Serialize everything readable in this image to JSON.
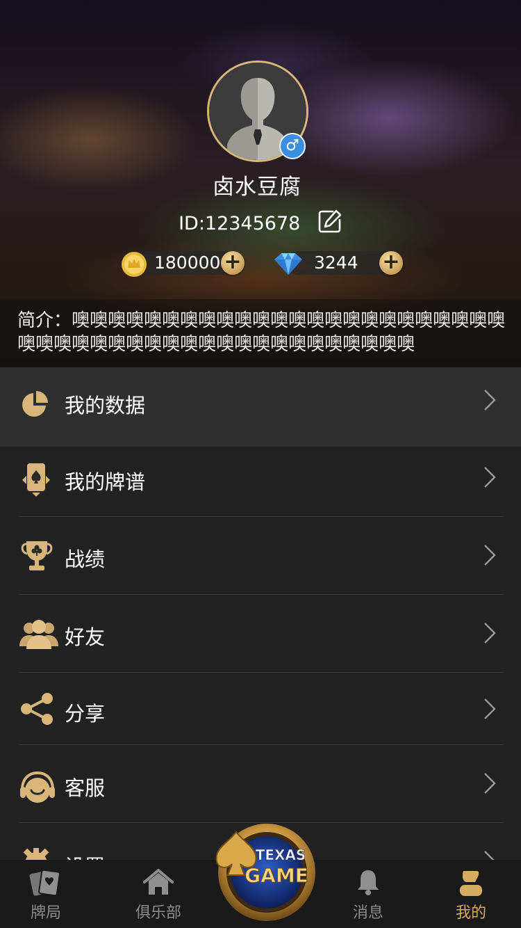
{
  "profile": {
    "nickname": "卤水豆腐",
    "gender_icon": "male-icon",
    "id_text": "ID:12345678",
    "coins": "180000",
    "diamonds": "3244",
    "bio": "简介：噢噢噢噢噢噢噢噢噢噢噢噢噢噢噢噢噢噢噢噢噢噢噢噢噢噢噢噢噢噢噢噢噢噢噢噢噢噢噢噢噢噢噢噢噢噢"
  },
  "menu": {
    "items": [
      {
        "label": "我的数据",
        "icon": "pie-chart-icon"
      },
      {
        "label": "我的牌谱",
        "icon": "card-icon"
      },
      {
        "label": "战绩",
        "icon": "trophy-icon"
      },
      {
        "label": "好友",
        "icon": "friends-icon"
      },
      {
        "label": "分享",
        "icon": "share-icon"
      },
      {
        "label": "客服",
        "icon": "headset-icon"
      },
      {
        "label": "设置",
        "icon": "gear-icon"
      }
    ]
  },
  "nav": {
    "items": [
      {
        "label": "牌局",
        "icon": "cards-icon"
      },
      {
        "label": "俱乐部",
        "icon": "home-icon"
      },
      {
        "label": "消息",
        "icon": "bell-icon"
      },
      {
        "label": "我的",
        "icon": "user-icon",
        "active": true
      }
    ],
    "logo_text_top": "TEXAS",
    "logo_text_bottom": "GAME"
  },
  "colors": {
    "accent_gold": "#d6ac63",
    "background": "#222222",
    "highlight_row": "#2f2f2f",
    "gender_blue": "#3b8fe3"
  }
}
